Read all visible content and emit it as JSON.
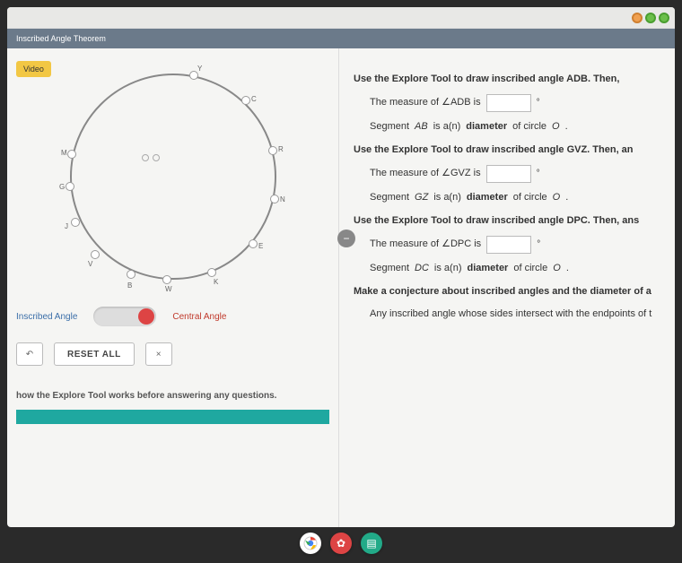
{
  "header": {
    "title": "Inscribed Angle Theorem"
  },
  "left": {
    "video_btn": "Video",
    "points": [
      "Y",
      "C",
      "R",
      "N",
      "E",
      "K",
      "W",
      "B",
      "V",
      "J",
      "G",
      "M"
    ],
    "toggle": {
      "left": "Inscribed Angle",
      "right": "Central Angle"
    },
    "buttons": {
      "undo": "↶",
      "reset": "RESET ALL",
      "close": "×"
    },
    "hint": "how the Explore Tool works before answering any questions."
  },
  "right": {
    "q1": {
      "prompt": "Use the Explore Tool to draw inscribed angle ADB. Then,",
      "m": "The measure of ∠ADB is",
      "s1": "Segment ",
      "seg": "AB",
      "s2": " is a(n) ",
      "rel": "diameter",
      "s3": " of circle ",
      "c": "O",
      "s4": "."
    },
    "q2": {
      "prompt": "Use the Explore Tool to draw inscribed angle GVZ. Then, an",
      "m": "The measure of ∠GVZ is",
      "s1": "Segment ",
      "seg": "GZ",
      "s2": " is a(n) ",
      "rel": "diameter",
      "s3": " of circle ",
      "c": "O",
      "s4": "."
    },
    "q3": {
      "prompt": "Use the Explore Tool to draw inscribed angle DPC. Then, ans",
      "m": "The measure of ∠DPC is",
      "s1": "Segment ",
      "seg": "DC",
      "s2": " is a(n) ",
      "rel": "diameter",
      "s3": " of circle ",
      "c": "O",
      "s4": "."
    },
    "conj": "Make a conjecture about inscribed angles and the diameter of a",
    "ans": "Any inscribed angle whose sides intersect with the endpoints of t"
  },
  "deg": "°"
}
